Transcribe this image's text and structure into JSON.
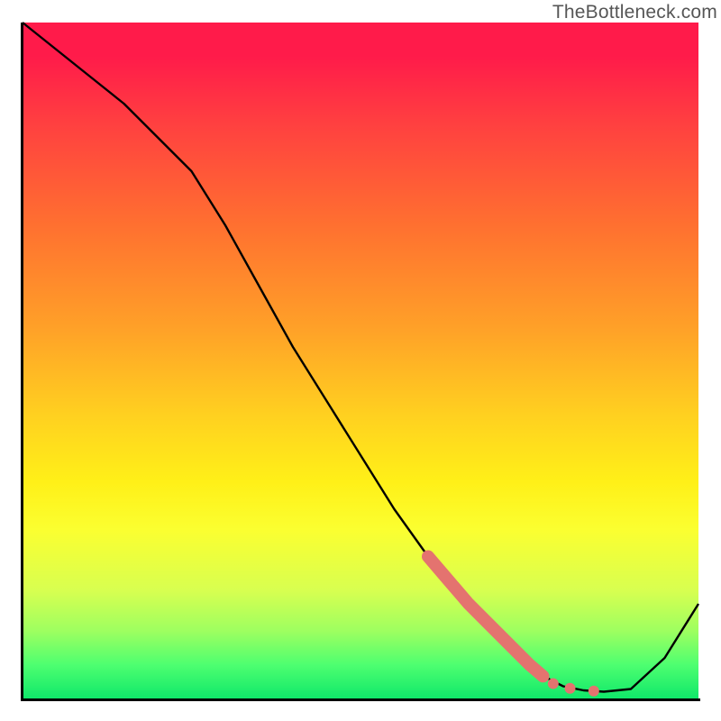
{
  "watermark": "TheBottleneck.com",
  "chart_data": {
    "type": "line",
    "title": "",
    "xlabel": "",
    "ylabel": "",
    "xlim": [
      0,
      100
    ],
    "ylim": [
      0,
      100
    ],
    "grid": false,
    "legend": false,
    "series": [
      {
        "name": "bottleneck-curve",
        "color": "#000000",
        "x": [
          0,
          5,
          10,
          15,
          20,
          25,
          30,
          35,
          40,
          45,
          50,
          55,
          60,
          65,
          70,
          75,
          78,
          80,
          83,
          86,
          90,
          95,
          100
        ],
        "y": [
          100,
          96,
          92,
          88,
          83,
          78,
          70,
          61,
          52,
          44,
          36,
          28,
          21,
          15,
          10,
          5,
          2.8,
          1.8,
          1.2,
          1.0,
          1.4,
          6,
          14
        ]
      }
    ],
    "highlight_segment": {
      "color": "#e4736f",
      "x": [
        60,
        63,
        66,
        69,
        72,
        75,
        77
      ],
      "y": [
        21,
        17.5,
        14,
        11,
        8,
        5,
        3.3
      ]
    },
    "dots": {
      "color": "#e4736f",
      "radius_px": 6,
      "points": [
        {
          "x": 78.5,
          "y": 2.2
        },
        {
          "x": 81,
          "y": 1.5
        },
        {
          "x": 84.5,
          "y": 1.1
        }
      ]
    },
    "gradient_stops": [
      {
        "pct": 0,
        "color": "#ff1b4a"
      },
      {
        "pct": 5,
        "color": "#ff1b4a"
      },
      {
        "pct": 15,
        "color": "#ff4040"
      },
      {
        "pct": 30,
        "color": "#ff7030"
      },
      {
        "pct": 45,
        "color": "#ffa028"
      },
      {
        "pct": 58,
        "color": "#ffd020"
      },
      {
        "pct": 68,
        "color": "#fff018"
      },
      {
        "pct": 75,
        "color": "#fbff30"
      },
      {
        "pct": 84,
        "color": "#d8ff50"
      },
      {
        "pct": 90,
        "color": "#9eff60"
      },
      {
        "pct": 95,
        "color": "#4eff70"
      },
      {
        "pct": 100,
        "color": "#10e86a"
      }
    ]
  }
}
